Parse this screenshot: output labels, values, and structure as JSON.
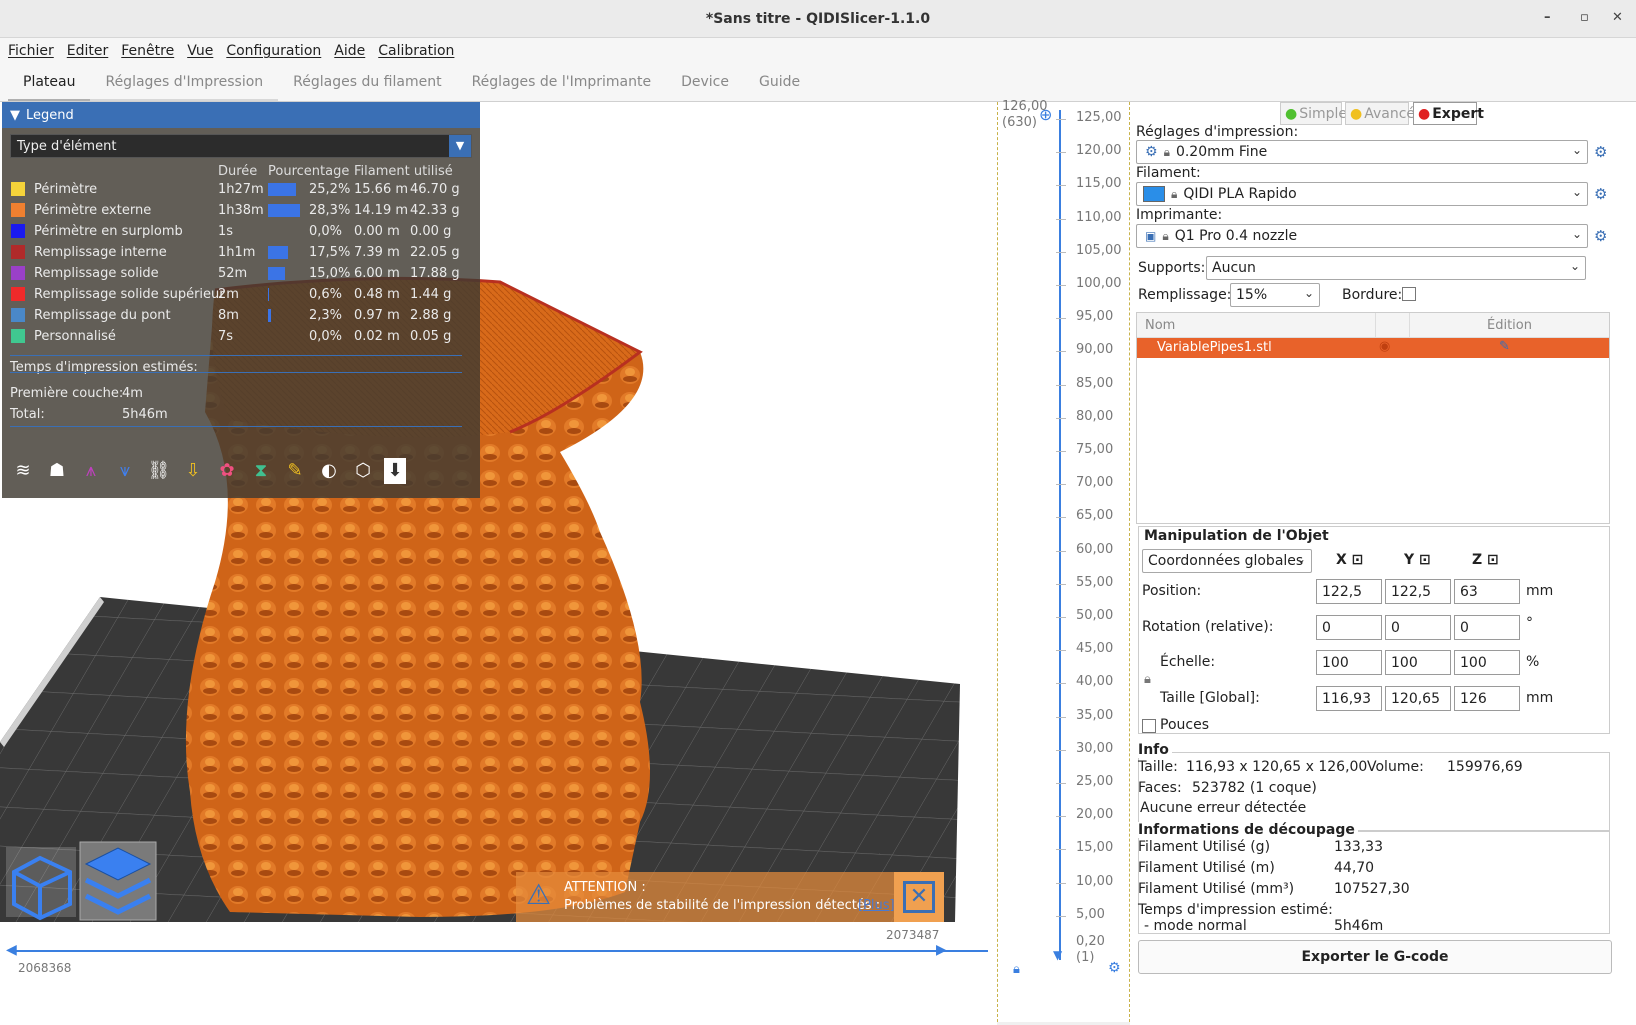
{
  "window": {
    "title": "*Sans titre - QIDISlicer-1.1.0"
  },
  "menu": [
    "Fichier",
    "Editer",
    "Fenêtre",
    "Vue",
    "Configuration",
    "Aide",
    "Calibration"
  ],
  "tabs": [
    "Plateau",
    "Réglages d'Impression",
    "Réglages du filament",
    "Réglages de l'Imprimante",
    "Device",
    "Guide"
  ],
  "legend": {
    "title": "Legend",
    "type_select": "Type d'élément",
    "headers": {
      "duration": "Durée",
      "percent": "Pourcentage",
      "filament": "Filament utilisé"
    },
    "rows": [
      {
        "name": "Périmètre",
        "color": "#f5d33a",
        "time": "1h27m",
        "pct": "25,2%",
        "pct_value": 25.2,
        "len": "15.66 m",
        "weight": "46.70 g"
      },
      {
        "name": "Périmètre externe",
        "color": "#f08030",
        "time": "1h38m",
        "pct": "28,3%",
        "pct_value": 28.3,
        "len": "14.19 m",
        "weight": "42.33 g"
      },
      {
        "name": "Périmètre en surplomb",
        "color": "#1a1af0",
        "time": "1s",
        "pct": "0,0%",
        "pct_value": 0,
        "len": "0.00 m",
        "weight": "0.00 g"
      },
      {
        "name": "Remplissage interne",
        "color": "#b02a2a",
        "time": "1h1m",
        "pct": "17,5%",
        "pct_value": 17.5,
        "len": "7.39 m",
        "weight": "22.05 g"
      },
      {
        "name": "Remplissage solide",
        "color": "#9a40c8",
        "time": "52m",
        "pct": "15,0%",
        "pct_value": 15.0,
        "len": "6.00 m",
        "weight": "17.88 g"
      },
      {
        "name": "Remplissage solide supérieur",
        "color": "#f02a2a",
        "time": "2m",
        "pct": "0,6%",
        "pct_value": 0.6,
        "len": "0.48 m",
        "weight": "1.44 g"
      },
      {
        "name": "Remplissage du pont",
        "color": "#4a88c8",
        "time": "8m",
        "pct": "2,3%",
        "pct_value": 2.3,
        "len": "0.97 m",
        "weight": "2.88 g"
      },
      {
        "name": "Personnalisé",
        "color": "#40c890",
        "time": "7s",
        "pct": "0,0%",
        "pct_value": 0,
        "len": "0.02 m",
        "weight": "0.05 g"
      }
    ],
    "estimated_label": "Temps d'impression estimés:",
    "first_layer_label": "Première couche:",
    "first_layer": "4m",
    "total_label": "Total:",
    "total": "5h46m"
  },
  "warning": {
    "title": "ATTENTION :",
    "text": "Problèmes de stabilité de l'impression détectés :",
    "link": "[Plus]"
  },
  "hslider": {
    "right": "2073487",
    "left": "2068368"
  },
  "vslider": {
    "top": "126,00",
    "top_sub": "(630)",
    "bottom": "0,20",
    "bottom_sub": "(1)",
    "ticks": [
      "125,00",
      "120,00",
      "115,00",
      "110,00",
      "105,00",
      "100,00",
      "95,00",
      "90,00",
      "85,00",
      "80,00",
      "75,00",
      "70,00",
      "65,00",
      "60,00",
      "55,00",
      "50,00",
      "45,00",
      "40,00",
      "35,00",
      "30,00",
      "25,00",
      "20,00",
      "15,00",
      "10,00",
      "5,00"
    ]
  },
  "panel": {
    "modes": {
      "simple": "Simple",
      "advanced": "Avancé",
      "expert": "Expert"
    },
    "print_label": "Réglages d'impression:",
    "print_value": "0.20mm Fine",
    "filament_label": "Filament:",
    "filament_value": "QIDI PLA Rapido",
    "printer_label": "Imprimante:",
    "printer_value": "Q1 Pro 0.4 nozzle",
    "supports_label": "Supports:",
    "supports_value": "Aucun",
    "infill_label": "Remplissage:",
    "infill_value": "15%",
    "brim_label": "Bordure:",
    "list_name": "Nom",
    "list_edit": "Édition",
    "object_name": "VariablePipes1.stl",
    "manip_title": "Manipulation de l'Objet",
    "coord_value": "Coordonnées globales",
    "axes": [
      "X",
      "Y",
      "Z"
    ],
    "position_label": "Position:",
    "position": [
      "122,5",
      "122,5",
      "63"
    ],
    "position_unit": "mm",
    "rotation_label": "Rotation (relative):",
    "rotation": [
      "0",
      "0",
      "0"
    ],
    "rotation_unit": "°",
    "scale_label": "Échelle:",
    "scale": [
      "100",
      "100",
      "100"
    ],
    "scale_unit": "%",
    "size_label": "Taille [Global]:",
    "size": [
      "116,93",
      "120,65",
      "126"
    ],
    "size_unit": "mm",
    "inches_label": "Pouces",
    "info_title": "Info",
    "info_size_label": "Taille:",
    "info_size": "116,93 x 120,65 x 126,00",
    "info_volume_label": "Volume:",
    "info_volume": "159976,69",
    "info_faces_label": "Faces:",
    "info_faces": "523782 (1 coque)",
    "info_errors": "Aucune erreur détectée",
    "slice_title": "Informations de découpage",
    "slice_rows": [
      {
        "label": "Filament Utilisé (g)",
        "value": "133,33"
      },
      {
        "label": "Filament Utilisé (m)",
        "value": "44,70"
      },
      {
        "label": "Filament Utilisé (mm³)",
        "value": "107527,30"
      }
    ],
    "time_label": "Temps d'impression estimé:",
    "mode_label": "- mode normal",
    "mode_value": "5h46m",
    "export_label": "Exporter le G-code"
  },
  "colors": {
    "accent": "#3a6fb5",
    "selected_row": "#e8622a",
    "model": "#d8691e",
    "bed": "#3a3a3a"
  }
}
